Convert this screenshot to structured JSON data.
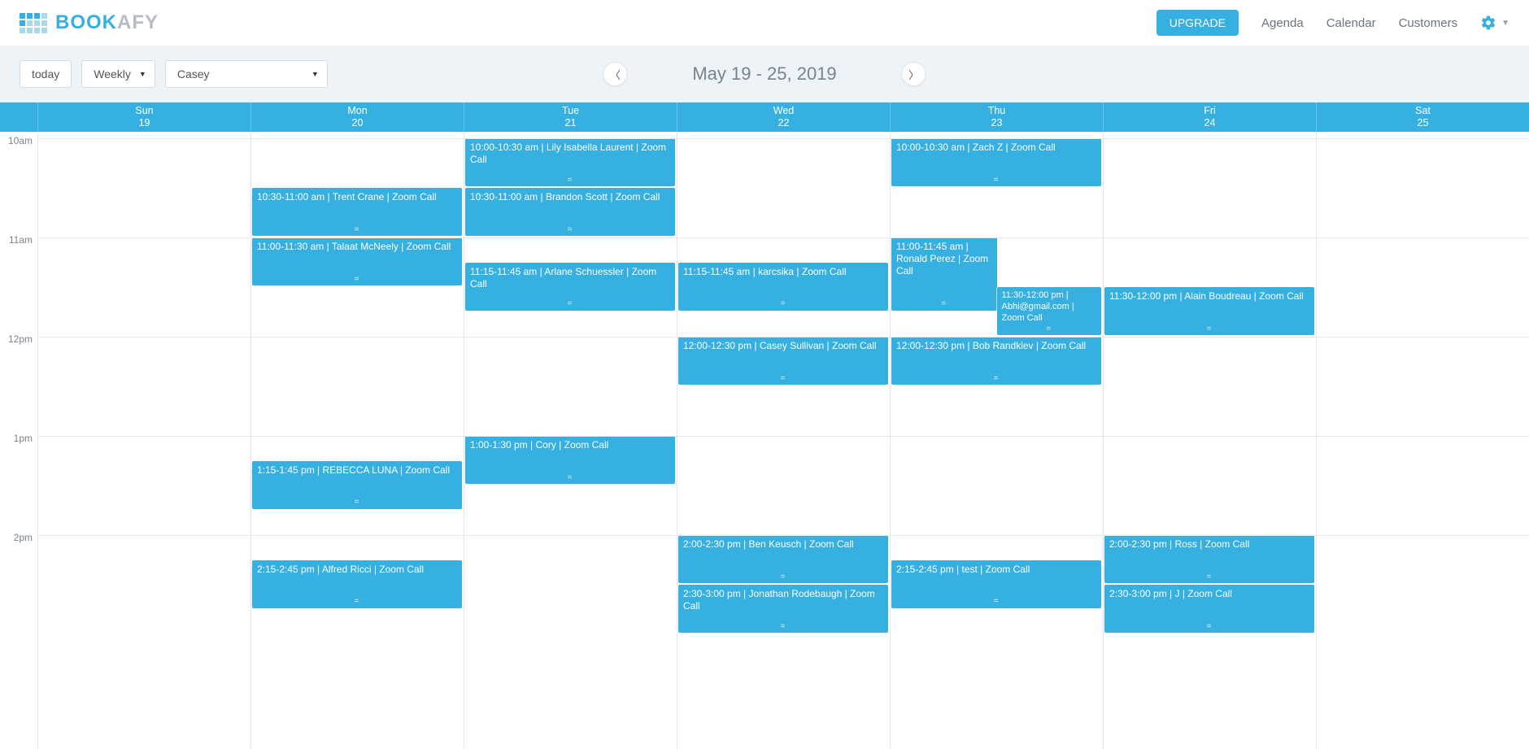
{
  "brand": {
    "part1": "BOOK",
    "part2": "AFY"
  },
  "nav": {
    "upgrade": "UPGRADE",
    "agenda": "Agenda",
    "calendar": "Calendar",
    "customers": "Customers"
  },
  "toolbar": {
    "today": "today",
    "view": "Weekly",
    "user": "Casey",
    "range": "May 19 - 25, 2019"
  },
  "hourHeight": 122,
  "startHour": 10,
  "hours": [
    "10am",
    "11am",
    "12pm",
    "1pm",
    "2pm"
  ],
  "days": [
    {
      "dow": "Sun",
      "num": "19"
    },
    {
      "dow": "Mon",
      "num": "20"
    },
    {
      "dow": "Tue",
      "num": "21"
    },
    {
      "dow": "Wed",
      "num": "22"
    },
    {
      "dow": "Thu",
      "num": "23"
    },
    {
      "dow": "Fri",
      "num": "24"
    },
    {
      "dow": "Sat",
      "num": "25"
    }
  ],
  "events": [
    {
      "day": 1,
      "start": 10.5,
      "end": 11.0,
      "label": "10:30-11:00 am | Trent Crane | Zoom Call"
    },
    {
      "day": 1,
      "start": 11.0,
      "end": 11.5,
      "label": "11:00-11:30 am | Talaat McNeely | Zoom Call"
    },
    {
      "day": 1,
      "start": 13.25,
      "end": 13.75,
      "label": "1:15-1:45 pm | REBECCA LUNA | Zoom Call"
    },
    {
      "day": 1,
      "start": 14.25,
      "end": 14.75,
      "label": "2:15-2:45 pm | Alfred Ricci | Zoom Call"
    },
    {
      "day": 2,
      "start": 10.0,
      "end": 10.5,
      "label": "10:00-10:30 am | Lily Isabella Laurent | Zoom Call"
    },
    {
      "day": 2,
      "start": 10.5,
      "end": 11.0,
      "label": "10:30-11:00 am | Brandon Scott | Zoom Call"
    },
    {
      "day": 2,
      "start": 11.25,
      "end": 11.75,
      "label": "11:15-11:45 am | Arlane Schuessler | Zoom Call"
    },
    {
      "day": 2,
      "start": 13.0,
      "end": 13.5,
      "label": "1:00-1:30 pm | Cory | Zoom Call"
    },
    {
      "day": 3,
      "start": 11.25,
      "end": 11.75,
      "label": "11:15-11:45 am | karcsika | Zoom Call"
    },
    {
      "day": 3,
      "start": 12.0,
      "end": 12.5,
      "label": "12:00-12:30 pm | Casey Sullivan | Zoom Call"
    },
    {
      "day": 3,
      "start": 14.0,
      "end": 14.5,
      "label": "2:00-2:30 pm | Ben Keusch | Zoom Call"
    },
    {
      "day": 3,
      "start": 14.5,
      "end": 15.0,
      "label": "2:30-3:00 pm | Jonathan Rodebaugh | Zoom Call"
    },
    {
      "day": 4,
      "start": 10.0,
      "end": 10.5,
      "label": "10:00-10:30 am | Zach Z | Zoom Call"
    },
    {
      "day": 4,
      "start": 11.0,
      "end": 11.75,
      "label": "11:00-11:45 am | Ronald Perez | Zoom Call",
      "rightHalf": false,
      "leftHalf": true
    },
    {
      "day": 4,
      "start": 11.5,
      "end": 12.0,
      "label": "11:30-12:00 pm | Abhi@gmail.com | Zoom Call",
      "rightHalf": true
    },
    {
      "day": 4,
      "start": 12.0,
      "end": 12.5,
      "label": "12:00-12:30 pm | Bob Randklev | Zoom Call"
    },
    {
      "day": 4,
      "start": 14.25,
      "end": 14.75,
      "label": "2:15-2:45 pm | test | Zoom Call"
    },
    {
      "day": 5,
      "start": 11.5,
      "end": 12.0,
      "label": "11:30-12:00 pm | Alain Boudreau | Zoom Call"
    },
    {
      "day": 5,
      "start": 14.0,
      "end": 14.5,
      "label": "2:00-2:30 pm | Ross | Zoom Call"
    },
    {
      "day": 5,
      "start": 14.5,
      "end": 15.0,
      "label": "2:30-3:00 pm | J | Zoom Call"
    }
  ]
}
